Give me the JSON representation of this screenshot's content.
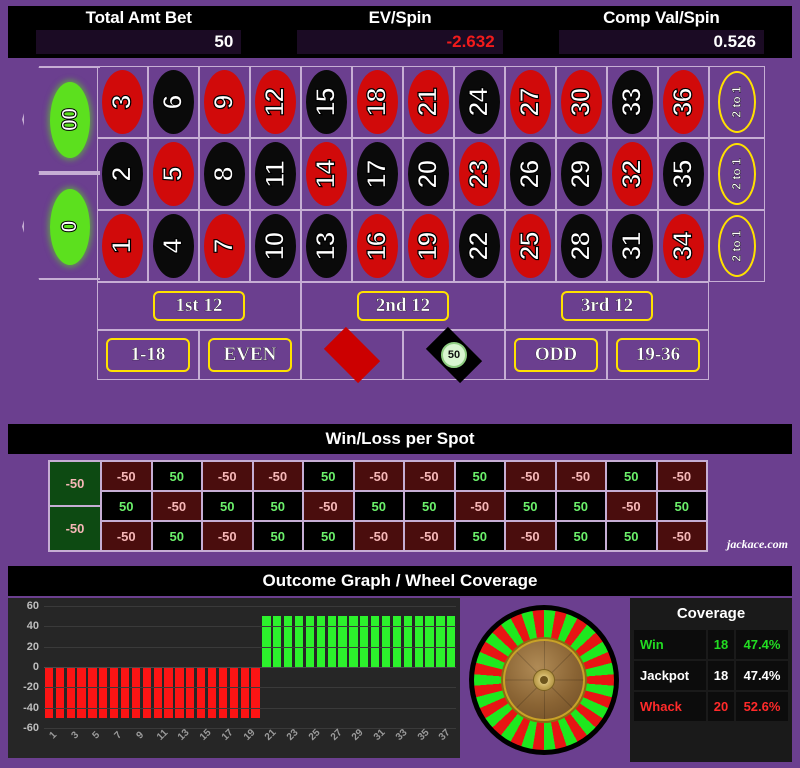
{
  "header": {
    "stats": [
      {
        "label": "Total Amt Bet",
        "value": "50",
        "negative": false
      },
      {
        "label": "EV/Spin",
        "value": "-2.632",
        "negative": true
      },
      {
        "label": "Comp Val/Spin",
        "value": "0.526",
        "negative": false
      }
    ]
  },
  "table": {
    "zeros": [
      {
        "label": "00",
        "color": "green"
      },
      {
        "label": "0",
        "color": "green"
      }
    ],
    "numbers": [
      {
        "n": "3",
        "color": "red"
      },
      {
        "n": "6",
        "color": "black"
      },
      {
        "n": "9",
        "color": "red"
      },
      {
        "n": "12",
        "color": "red"
      },
      {
        "n": "15",
        "color": "black"
      },
      {
        "n": "18",
        "color": "red"
      },
      {
        "n": "21",
        "color": "red"
      },
      {
        "n": "24",
        "color": "black"
      },
      {
        "n": "27",
        "color": "red"
      },
      {
        "n": "30",
        "color": "red"
      },
      {
        "n": "33",
        "color": "black"
      },
      {
        "n": "36",
        "color": "red"
      },
      {
        "n": "2",
        "color": "black"
      },
      {
        "n": "5",
        "color": "red"
      },
      {
        "n": "8",
        "color": "black"
      },
      {
        "n": "11",
        "color": "black"
      },
      {
        "n": "14",
        "color": "red"
      },
      {
        "n": "17",
        "color": "black"
      },
      {
        "n": "20",
        "color": "black"
      },
      {
        "n": "23",
        "color": "red"
      },
      {
        "n": "26",
        "color": "black"
      },
      {
        "n": "29",
        "color": "black"
      },
      {
        "n": "32",
        "color": "red"
      },
      {
        "n": "35",
        "color": "black"
      },
      {
        "n": "1",
        "color": "red"
      },
      {
        "n": "4",
        "color": "black"
      },
      {
        "n": "7",
        "color": "red"
      },
      {
        "n": "10",
        "color": "black"
      },
      {
        "n": "13",
        "color": "black"
      },
      {
        "n": "16",
        "color": "red"
      },
      {
        "n": "19",
        "color": "red"
      },
      {
        "n": "22",
        "color": "black"
      },
      {
        "n": "25",
        "color": "red"
      },
      {
        "n": "28",
        "color": "black"
      },
      {
        "n": "31",
        "color": "black"
      },
      {
        "n": "34",
        "color": "red"
      }
    ],
    "column_bets": [
      "2 to 1",
      "2 to 1",
      "2 to 1"
    ],
    "dozens": [
      "1st 12",
      "2nd 12",
      "3rd 12"
    ],
    "outside": [
      {
        "kind": "text",
        "label": "1-18"
      },
      {
        "kind": "text",
        "label": "EVEN"
      },
      {
        "kind": "diamond",
        "label": "",
        "swatch": "red",
        "bet": null
      },
      {
        "kind": "diamond",
        "label": "",
        "swatch": "black",
        "bet": "50"
      },
      {
        "kind": "text",
        "label": "ODD"
      },
      {
        "kind": "text",
        "label": "19-36"
      }
    ]
  },
  "winloss": {
    "title": "Win/Loss per Spot",
    "watermark": "jackace.com",
    "zero_cells": [
      "-50",
      "-50"
    ],
    "rows": [
      [
        "-50",
        "50",
        "-50",
        "-50",
        "50",
        "-50",
        "-50",
        "50",
        "-50",
        "-50",
        "50",
        "-50"
      ],
      [
        "50",
        "-50",
        "50",
        "50",
        "-50",
        "50",
        "50",
        "-50",
        "50",
        "50",
        "-50",
        "50"
      ],
      [
        "-50",
        "50",
        "-50",
        "50",
        "50",
        "-50",
        "-50",
        "50",
        "-50",
        "50",
        "50",
        "-50"
      ]
    ]
  },
  "outcome": {
    "title": "Outcome Graph / Wheel Coverage",
    "coverage": {
      "title": "Coverage",
      "rows": [
        {
          "name": "Win",
          "count": "18",
          "pct": "47.4%"
        },
        {
          "name": "Jackpot",
          "count": "18",
          "pct": "47.4%"
        },
        {
          "name": "Whack",
          "count": "20",
          "pct": "52.6%"
        }
      ]
    }
  },
  "chart_data": {
    "type": "bar",
    "title": "Outcome Graph / Wheel Coverage",
    "xlabel": "",
    "ylabel": "",
    "ylim": [
      -60,
      60
    ],
    "yticks": [
      60,
      40,
      20,
      0,
      -20,
      -40,
      -60
    ],
    "grid": true,
    "legend": "none",
    "categories": [
      "1",
      "2",
      "3",
      "4",
      "5",
      "6",
      "7",
      "8",
      "9",
      "10",
      "11",
      "12",
      "13",
      "14",
      "15",
      "16",
      "17",
      "18",
      "19",
      "20",
      "21",
      "22",
      "23",
      "24",
      "25",
      "26",
      "27",
      "28",
      "29",
      "30",
      "31",
      "32",
      "33",
      "34",
      "35",
      "36",
      "37",
      "38"
    ],
    "xtick_labels": [
      "1",
      "3",
      "5",
      "7",
      "9",
      "11",
      "13",
      "15",
      "17",
      "19",
      "21",
      "23",
      "25",
      "27",
      "29",
      "31",
      "33",
      "35",
      "37"
    ],
    "values": [
      -50,
      -50,
      -50,
      -50,
      -50,
      -50,
      -50,
      -50,
      -50,
      -50,
      -50,
      -50,
      -50,
      -50,
      -50,
      -50,
      -50,
      -50,
      -50,
      -50,
      50,
      50,
      50,
      50,
      50,
      50,
      50,
      50,
      50,
      50,
      50,
      50,
      50,
      50,
      50,
      50,
      50,
      50
    ],
    "positive_color": "#2cf22c",
    "negative_color": "#fc1414",
    "plot_bg": "#262626"
  },
  "theme": {
    "felt": "#6b3f8f",
    "red": "#d10a0a",
    "black": "#0a0a0a",
    "green": "#5ce01e",
    "yellow": "#ffe100",
    "gridline": "#c6aed4"
  }
}
